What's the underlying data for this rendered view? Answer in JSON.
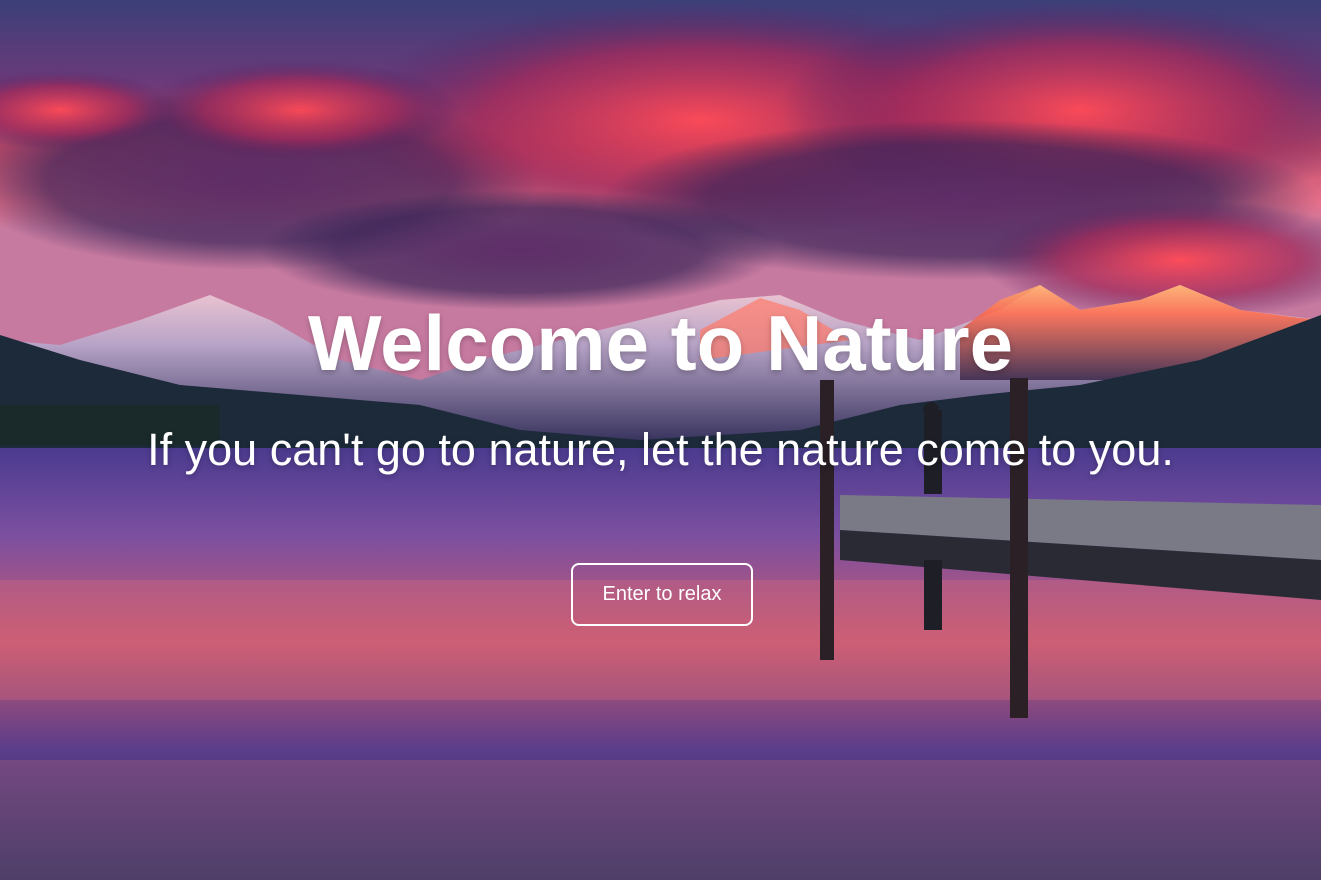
{
  "hero": {
    "title": "Welcome to Nature",
    "subtitle": "If you can't go to nature, let the nature come to you.",
    "button_label": "Enter to relax"
  },
  "colors": {
    "text": "#ffffff",
    "button_border": "#ffffff"
  },
  "background": {
    "icon": "sunset-lake-mountains-photo"
  }
}
